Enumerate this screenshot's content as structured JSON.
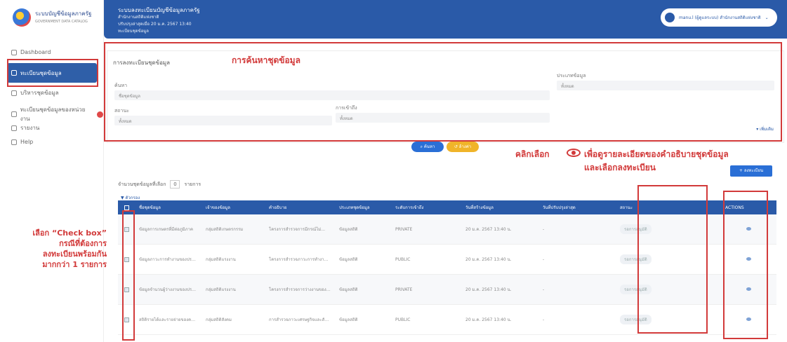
{
  "sidebar": {
    "logo_title": "ระบบบัญชีข้อมูลภาครัฐ",
    "logo_sub": "GOVERNMENT DATA CATALOG",
    "items": [
      {
        "label": "Dashboard"
      },
      {
        "label": "ทะเบียนชุดข้อมูล"
      },
      {
        "label": "บริหารชุดข้อมูล"
      },
      {
        "label": "ทะเบียนชุดข้อมูลของหน่วยงาน"
      },
      {
        "label": "รายงาน"
      },
      {
        "label": "Help"
      }
    ]
  },
  "header": {
    "system": "ระบบลงทะเบียนบัญชีข้อมูลภาครัฐ",
    "org": "สำนักงานสถิติแห่งชาติ",
    "updated": "ปรับปรุงล่าสุดเมื่อ 20 ม.ค. 2567 13:40",
    "crumb": "ทะเบียนชุดข้อมูล",
    "user": "manu.l (ผู้ดูแลระบบ) สำนักงานสถิติแห่งชาติ"
  },
  "search_panel": {
    "title": "การลงทะเบียนชุดข้อมูล",
    "keyword_label": "ค้นหา",
    "keyword_placeholder": "ชื่อชุดข้อมูล",
    "type_label": "ประเภทข้อมูล",
    "type_value": "ทั้งหมด",
    "status_label": "สถานะ",
    "status_value": "ทั้งหมด",
    "access_label": "การเข้าถึง",
    "access_value": "ทั้งหมด",
    "more": "เพิ่มเติม"
  },
  "buttons": {
    "search": "ค้นหา",
    "clear": "ล้างค่า",
    "register": "ลงทะเบียน"
  },
  "selected": {
    "label": "จำนวนชุดข้อมูลที่เลือก",
    "count": "0",
    "unit": "รายการ"
  },
  "filter_link": "ตัวกรอง",
  "table": {
    "headers": [
      "ชื่อชุดข้อมูล",
      "เจ้าของข้อมูล",
      "คำอธิบาย",
      "ประเภทชุดข้อมูล",
      "ระดับการเข้าถึง",
      "วันที่สร้างข้อมูล",
      "วันที่ปรับปรุงล่าสุด",
      "สถานะ",
      "ACTIONS"
    ],
    "rows": [
      {
        "name": "ข้อมูลการเกษตรที่มีต่อภูมิภาค",
        "owner": "กลุ่มสถิติเกษตรกรรม",
        "desc": "โครงการสำรวจการมีกรณ์ไม่...",
        "type": "ข้อมูลสถิติ",
        "access": "PRIVATE",
        "created": "20 ม.ค. 2567 13:40 น.",
        "updated": "-",
        "status": "รอการอนุมัติ"
      },
      {
        "name": "ข้อมูลภาวะการทำงานของประชากร",
        "owner": "กลุ่มสถิติแรงงาน",
        "desc": "โครงการสำรวจภาวะการทำงานของประชากร...",
        "type": "ข้อมูลสถิติ",
        "access": "PUBLIC",
        "created": "20 ม.ค. 2567 13:40 น.",
        "updated": "-",
        "status": "รอการอนุมัติ"
      },
      {
        "name": "ข้อมูลจำนวนผู้ว่างงานของประเทศไทย",
        "owner": "กลุ่มสถิติแรงงาน",
        "desc": "โครงการสำรวจการว่างงานของแรงงาน...",
        "type": "ข้อมูลสถิติ",
        "access": "PRIVATE",
        "created": "20 ม.ค. 2567 13:40 น.",
        "updated": "-",
        "status": "รอการอนุมัติ"
      },
      {
        "name": "สถิติรายได้และรายจ่ายของครัวเรือน",
        "owner": "กลุ่มสถิติสังคม",
        "desc": "การสำรวจภาวะเศรษฐกิจและสังคม...",
        "type": "ข้อมูลสถิติ",
        "access": "PUBLIC",
        "created": "20 ม.ค. 2567 13:40 น.",
        "updated": "-",
        "status": "รอการอนุมัติ"
      }
    ]
  },
  "annotations": {
    "search_title": "การค้นหาชุดข้อมูล",
    "click_select": "คลิกเลือก",
    "eye_desc_1": "เพื่อดูรายละเอียดของคำอธิบายชุดข้อมูล",
    "eye_desc_2": "และเลือกลงทะเบียน",
    "check_1": "เลือก “Check box”",
    "check_2": "กรณีที่ต้องการ",
    "check_3": "ลงทะเบียนพร้อมกัน",
    "check_4": "มากกว่า 1 รายการ",
    "color": "#d23a3a"
  }
}
